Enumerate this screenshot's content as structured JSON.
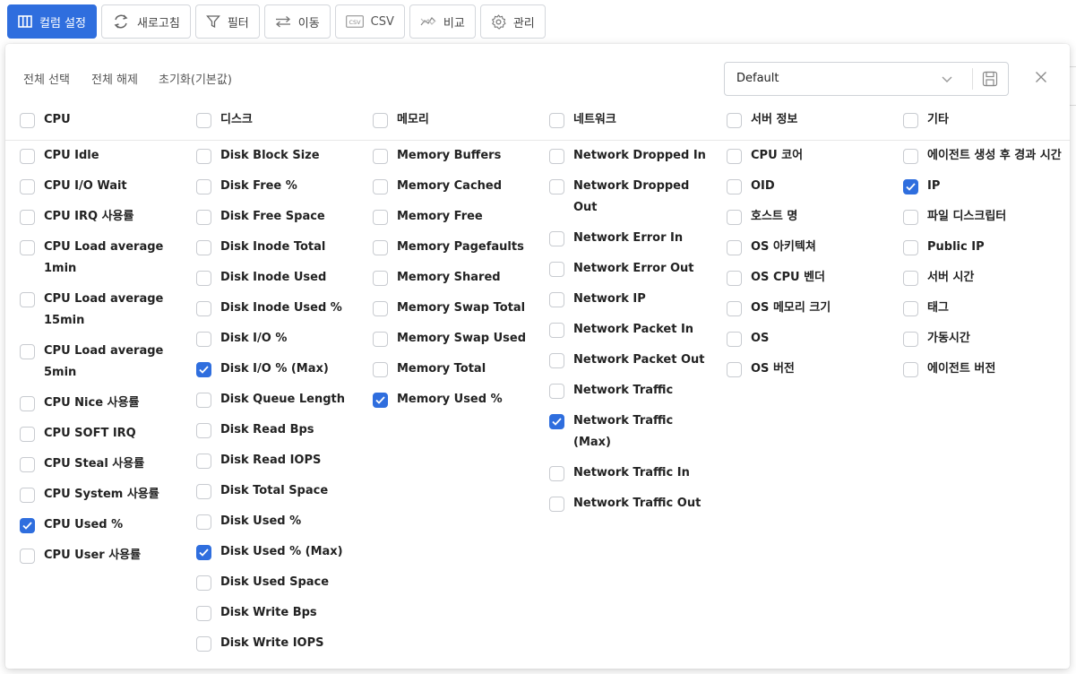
{
  "toolbar": {
    "buttons": [
      {
        "label": "컬럼 설정",
        "icon": "columns-icon"
      },
      {
        "label": "새로고침",
        "icon": "refresh-icon"
      },
      {
        "label": "필터",
        "icon": "filter-icon"
      },
      {
        "label": "이동",
        "icon": "move-icon"
      },
      {
        "label": "CSV",
        "icon": "csv-icon"
      },
      {
        "label": "비교",
        "icon": "compare-icon"
      },
      {
        "label": "관리",
        "icon": "gear-icon"
      }
    ]
  },
  "panel": {
    "select_all": "전체 선택",
    "deselect_all": "전체 해제",
    "reset": "초기화(기본값)",
    "preset": {
      "value": "Default"
    }
  },
  "colors": {
    "accent": "#2f6ede",
    "border": "#d4d7dc"
  },
  "columns": [
    {
      "header": "CPU",
      "items": [
        {
          "label": "CPU Idle",
          "checked": false
        },
        {
          "label": "CPU I/O Wait",
          "checked": false
        },
        {
          "label": "CPU IRQ 사용률",
          "checked": false
        },
        {
          "label": "CPU Load average 1min",
          "checked": false
        },
        {
          "label": "CPU Load average 15min",
          "checked": false
        },
        {
          "label": "CPU Load average 5min",
          "checked": false
        },
        {
          "label": "CPU Nice 사용률",
          "checked": false
        },
        {
          "label": "CPU SOFT IRQ",
          "checked": false
        },
        {
          "label": "CPU Steal 사용률",
          "checked": false
        },
        {
          "label": "CPU System 사용률",
          "checked": false
        },
        {
          "label": "CPU Used %",
          "checked": true
        },
        {
          "label": "CPU User 사용률",
          "checked": false
        }
      ]
    },
    {
      "header": "디스크",
      "items": [
        {
          "label": "Disk Block Size",
          "checked": false
        },
        {
          "label": "Disk Free %",
          "checked": false
        },
        {
          "label": "Disk Free Space",
          "checked": false
        },
        {
          "label": "Disk Inode Total",
          "checked": false
        },
        {
          "label": "Disk Inode Used",
          "checked": false
        },
        {
          "label": "Disk Inode Used %",
          "checked": false
        },
        {
          "label": "Disk I/O %",
          "checked": false
        },
        {
          "label": "Disk I/O % (Max)",
          "checked": true
        },
        {
          "label": "Disk Queue Length",
          "checked": false
        },
        {
          "label": "Disk Read Bps",
          "checked": false
        },
        {
          "label": "Disk Read IOPS",
          "checked": false
        },
        {
          "label": "Disk Total Space",
          "checked": false
        },
        {
          "label": "Disk Used %",
          "checked": false
        },
        {
          "label": "Disk Used % (Max)",
          "checked": true
        },
        {
          "label": "Disk Used Space",
          "checked": false
        },
        {
          "label": "Disk Write Bps",
          "checked": false
        },
        {
          "label": "Disk Write IOPS",
          "checked": false
        }
      ]
    },
    {
      "header": "메모리",
      "items": [
        {
          "label": "Memory Buffers",
          "checked": false
        },
        {
          "label": "Memory Cached",
          "checked": false
        },
        {
          "label": "Memory Free",
          "checked": false
        },
        {
          "label": "Memory Pagefaults",
          "checked": false
        },
        {
          "label": "Memory Shared",
          "checked": false
        },
        {
          "label": "Memory Swap Total",
          "checked": false
        },
        {
          "label": "Memory Swap Used",
          "checked": false
        },
        {
          "label": "Memory Total",
          "checked": false
        },
        {
          "label": "Memory Used %",
          "checked": true
        }
      ]
    },
    {
      "header": "네트워크",
      "items": [
        {
          "label": "Network Dropped In",
          "checked": false
        },
        {
          "label": "Network Dropped Out",
          "checked": false
        },
        {
          "label": "Network Error In",
          "checked": false
        },
        {
          "label": "Network Error Out",
          "checked": false
        },
        {
          "label": "Network IP",
          "checked": false
        },
        {
          "label": "Network Packet In",
          "checked": false
        },
        {
          "label": "Network Packet Out",
          "checked": false
        },
        {
          "label": "Network Traffic",
          "checked": false
        },
        {
          "label": "Network Traffic (Max)",
          "checked": true
        },
        {
          "label": "Network Traffic In",
          "checked": false
        },
        {
          "label": "Network Traffic Out",
          "checked": false
        }
      ]
    },
    {
      "header": "서버 정보",
      "items": [
        {
          "label": "CPU 코어",
          "checked": false
        },
        {
          "label": "OID",
          "checked": false
        },
        {
          "label": "호스트 명",
          "checked": false
        },
        {
          "label": "OS 아키텍쳐",
          "checked": false
        },
        {
          "label": "OS CPU 벤더",
          "checked": false
        },
        {
          "label": "OS 메모리 크기",
          "checked": false
        },
        {
          "label": "OS",
          "checked": false
        },
        {
          "label": "OS 버전",
          "checked": false
        }
      ]
    },
    {
      "header": "기타",
      "items": [
        {
          "label": "에이전트 생성 후 경과 시간",
          "checked": false
        },
        {
          "label": "IP",
          "checked": true
        },
        {
          "label": "파일 디스크립터",
          "checked": false
        },
        {
          "label": "Public IP",
          "checked": false
        },
        {
          "label": "서버 시간",
          "checked": false
        },
        {
          "label": "태그",
          "checked": false
        },
        {
          "label": "가동시간",
          "checked": false
        },
        {
          "label": "에이전트 버전",
          "checked": false
        }
      ]
    }
  ]
}
